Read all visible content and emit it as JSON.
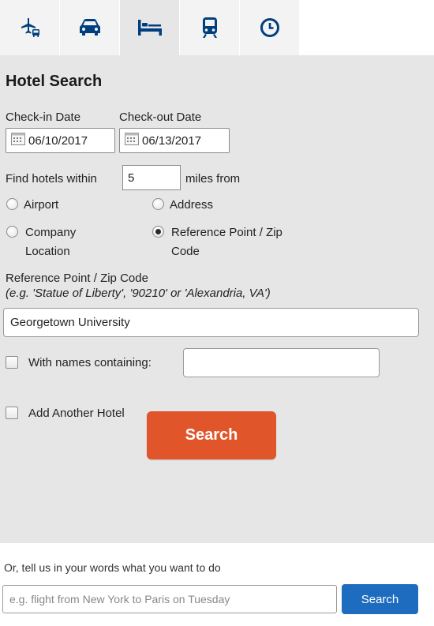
{
  "tabs": [
    {
      "icon": "flight-icon",
      "active": false
    },
    {
      "icon": "car-icon",
      "active": false
    },
    {
      "icon": "hotel-bed-icon",
      "active": true
    },
    {
      "icon": "train-icon",
      "active": false
    },
    {
      "icon": "clock-icon",
      "active": false
    }
  ],
  "colors": {
    "icon": "#003f7f",
    "accent_orange": "#e0552a",
    "accent_blue": "#1e6cbf",
    "panel_bg": "#e6e6e6"
  },
  "form": {
    "title": "Hotel Search",
    "checkin_label": "Check-in Date",
    "checkout_label": "Check-out Date",
    "checkin_value": "06/10/2017",
    "checkout_value": "06/13/2017",
    "within_label": "Find hotels within",
    "within_value": "5",
    "miles_from_label": "miles from",
    "radio_airport": "Airport",
    "radio_address": "Address",
    "radio_company_line1": "Company",
    "radio_company_line2": "Location",
    "radio_refpoint_line1": "Reference Point / Zip",
    "radio_refpoint_line2": "Code",
    "selected_radio": "Reference Point / Zip Code",
    "refpoint_label": "Reference Point / Zip Code",
    "refpoint_example": "(e.g. 'Statue of Liberty', '90210' or 'Alexandria, VA')",
    "refpoint_value": "Georgetown University",
    "names_containing_label": "With names containing:",
    "names_containing_value": "",
    "add_hotel_label": "Add Another Hotel",
    "search_label": "Search"
  },
  "natural_language": {
    "label": "Or, tell us in your words what you want to do",
    "placeholder": "e.g. flight from New York to Paris on Tuesday",
    "search_label": "Search"
  }
}
